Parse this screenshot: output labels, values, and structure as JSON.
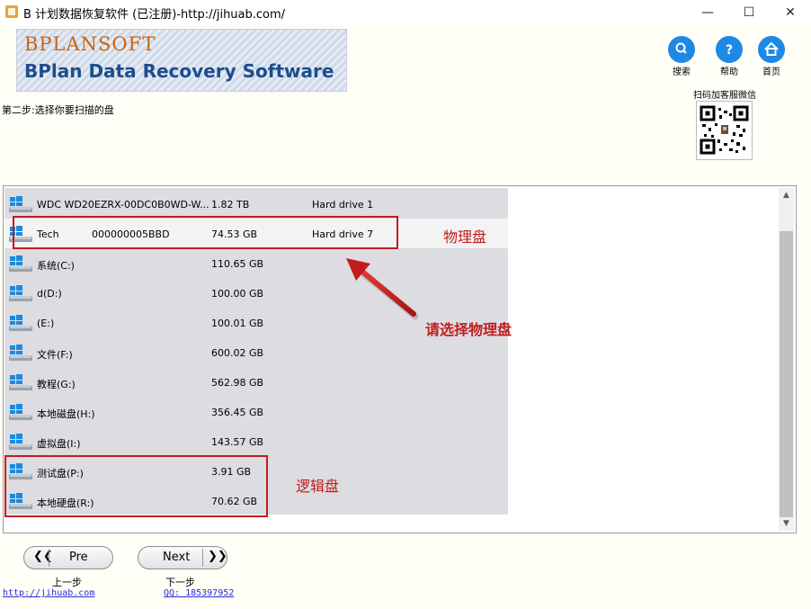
{
  "window": {
    "title": "B 计划数据恢复软件 (已注册)-http://jihuab.com/",
    "min_glyph": "—",
    "max_glyph": "☐",
    "close_glyph": "✕"
  },
  "banner": {
    "brand": "BPLANSOFT",
    "product": "BPlan Data Recovery Software"
  },
  "nav": [
    {
      "label": "搜索",
      "icon": "search-icon"
    },
    {
      "label": "帮助",
      "icon": "help-icon"
    },
    {
      "label": "首页",
      "icon": "home-icon"
    }
  ],
  "qr": {
    "title": "扫码加客服微信"
  },
  "step": {
    "text": "第二步:选择你要扫描的盘"
  },
  "drives": [
    {
      "name": "WDC WD20EZRX-00DC0B0WD-W...",
      "name2": "",
      "size": "1.82 TB",
      "type": "Hard drive 1"
    },
    {
      "name": "Tech",
      "name2": "000000005BBD",
      "size": "74.53 GB",
      "type": "Hard drive 7"
    },
    {
      "name": "系统(C:)",
      "name2": "",
      "size": "110.65 GB",
      "type": ""
    },
    {
      "name": "d(D:)",
      "name2": "",
      "size": "100.00 GB",
      "type": ""
    },
    {
      "name": "(E:)",
      "name2": "",
      "size": "100.01 GB",
      "type": ""
    },
    {
      "name": "文件(F:)",
      "name2": "",
      "size": "600.02 GB",
      "type": ""
    },
    {
      "name": "教程(G:)",
      "name2": "",
      "size": "562.98 GB",
      "type": ""
    },
    {
      "name": "本地磁盘(H:)",
      "name2": "",
      "size": "356.45 GB",
      "type": ""
    },
    {
      "name": "虚拟盘(I:)",
      "name2": "",
      "size": "143.57 GB",
      "type": ""
    },
    {
      "name": "测试盘(P:)",
      "name2": "",
      "size": "3.91 GB",
      "type": ""
    },
    {
      "name": "本地硬盘(R:)",
      "name2": "",
      "size": "70.62 GB",
      "type": ""
    }
  ],
  "annotations": {
    "physical": "物理盘",
    "select": "请选择物理盘",
    "logical": "逻辑盘",
    "color": "#c21c1c"
  },
  "buttons": {
    "prev": "Pre",
    "prev_caption": "上一步",
    "next": "Next",
    "next_caption": "下一步"
  },
  "footer": {
    "url": "http://jihuab.com",
    "qq": "QQ: 185397952"
  }
}
